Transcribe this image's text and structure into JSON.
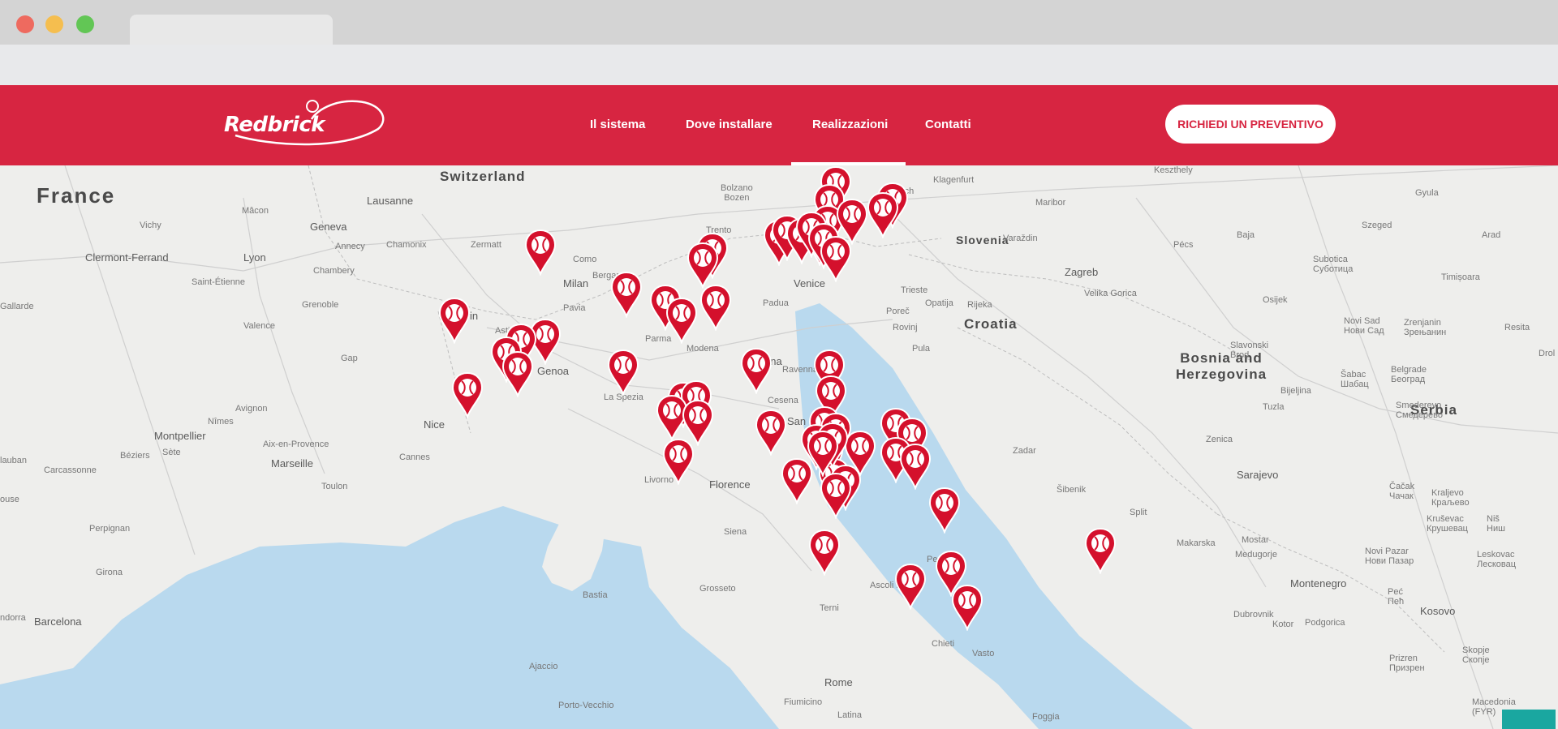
{
  "header": {
    "logo_text": "Redbrick",
    "nav": [
      {
        "label": "Il sistema"
      },
      {
        "label": "Dove installare"
      },
      {
        "label": "Realizzazioni"
      },
      {
        "label": "Contatti"
      }
    ],
    "cta_label": "RICHIEDI UN PREVENTIVO",
    "brand_color": "#d72541"
  },
  "map": {
    "countries": [
      "France",
      "Switzerland",
      "Slovenia",
      "Croatia",
      "Bosnia and Herzegovina",
      "Serbia"
    ],
    "cities": [
      "Lausanne",
      "Geneva",
      "Annecy",
      "Chamonix",
      "Mâcon",
      "Vichy",
      "Clermont-Ferrand",
      "Lyon",
      "Chambery",
      "Saint-Étienne",
      "Grenoble",
      "Valence",
      "Gap",
      "Avignon",
      "Nîmes",
      "Montpellier",
      "Aix-en-Provence",
      "Marseille",
      "Toulon",
      "Cannes",
      "Nice",
      "Béziers",
      "Sète",
      "Carcassonne",
      "Perpignan",
      "Girona",
      "Barcelona",
      "Zermatt",
      "Como",
      "Bergamo",
      "Milan",
      "Turin",
      "Asti",
      "Pavia",
      "Parma",
      "Modena",
      "Bologna",
      "Genoa",
      "La Spezia",
      "Livorno",
      "Florence",
      "Siena",
      "Grosseto",
      "Bastia",
      "Ajaccio",
      "Porto-Vecchio",
      "Bolzano\nBozen",
      "Trento",
      "Villach",
      "Klagenfurt",
      "Maribor",
      "Padua",
      "Venice",
      "Trieste",
      "Opatija",
      "Rijeka",
      "Poreč",
      "Rovinj",
      "Pula",
      "Zagreb",
      "Velika Gorica",
      "Varaždin",
      "Keszthely",
      "Pécs",
      "Baja",
      "Szeged",
      "Gyula",
      "Arad",
      "Subotica\nСуботица",
      "Timișoara",
      "Osijek",
      "Novi Sad\nНови Сад",
      "Zrenjanin\nЗрењанин",
      "Resita",
      "Slavonski\nBrod",
      "Bijeljina",
      "Šabac\nШабац",
      "Belgrade\nБеоград",
      "Tuzla",
      "Smederevo\nСмедерево",
      "Zenica",
      "Sarajevo",
      "Zadar",
      "Šibenik",
      "Split",
      "Makarska",
      "Mostar",
      "Medugorje",
      "Čačak\nЧачак",
      "Kraljevo\nКраљево",
      "Kruševac\nКрушевац",
      "Niš\nНиш",
      "Novi Pazar\nНови Пазар",
      "Leskovac\nЛесковац",
      "Montenegro",
      "Peć\nПећ",
      "Dubrovnik",
      "Kotor",
      "Podgorica",
      "Kosovo",
      "Prizren\nПризрен",
      "Skopje\nСкопје",
      "Macedonia\n(FYR)",
      "Ravenna",
      "Cesena",
      "San Marino",
      "Ascoli Piceno",
      "Pescara",
      "Chieti",
      "Vasto",
      "Terni",
      "Rome",
      "Fiumicino",
      "Latina",
      "Foggia",
      "Drol",
      "Gallarde",
      "ouse",
      "ndorra",
      "lauban"
    ],
    "pin_color": "#d4102c",
    "pin_icon": "tennis-ball-icon"
  }
}
